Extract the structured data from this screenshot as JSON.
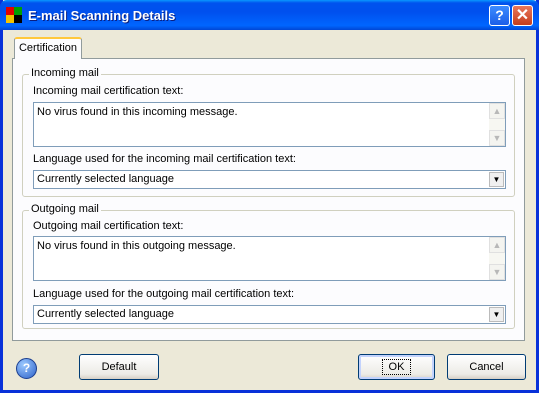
{
  "window": {
    "title": "E-mail Scanning Details"
  },
  "tabs": [
    {
      "label": "Certification"
    }
  ],
  "incoming": {
    "group_label": "Incoming mail",
    "text_label": "Incoming mail certification text:",
    "text_value": "No virus found in this incoming message.",
    "lang_label": "Language used for the incoming mail certification text:",
    "lang_value": "Currently selected language"
  },
  "outgoing": {
    "group_label": "Outgoing mail",
    "text_label": "Outgoing mail certification text:",
    "text_value": "No virus found in this outgoing message.",
    "lang_label": "Language used for the outgoing mail certification text:",
    "lang_value": "Currently selected language"
  },
  "buttons": {
    "default": "Default",
    "ok": "OK",
    "cancel": "Cancel"
  },
  "icons": {
    "help_title": "question-mark-icon",
    "close": "close-icon",
    "help_footer": "help-icon"
  }
}
